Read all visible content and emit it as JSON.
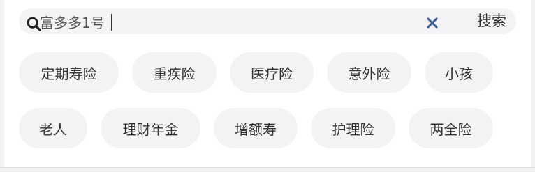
{
  "search": {
    "value": "富多多1号",
    "button_label": "搜索"
  },
  "icons": {
    "search": "search-icon",
    "clear": "close-icon"
  },
  "colors": {
    "clear_icon": "#3b5a8f",
    "tag_bg": "#f3f3f3",
    "search_bg": "#f3f3f6"
  },
  "tags": {
    "row1": [
      "定期寿险",
      "重疾险",
      "医疗险",
      "意外险",
      "小孩"
    ],
    "row2": [
      "老人",
      "理财年金",
      "增额寿",
      "护理险",
      "两全险"
    ]
  }
}
